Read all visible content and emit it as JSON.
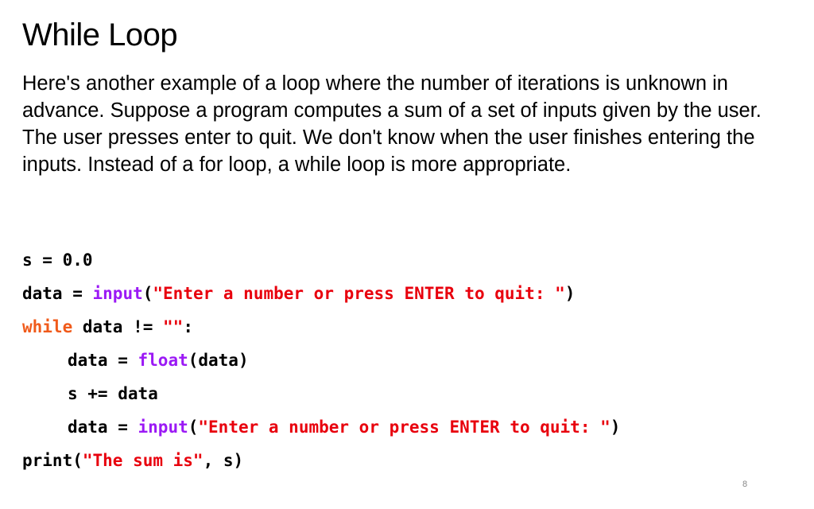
{
  "slide": {
    "title": "While Loop",
    "body": "Here's another example of a loop where the number of iterations is unknown in advance. Suppose a program computes a sum of a set of inputs given by the user. The user presses enter to quit.  We don't know when the user finishes entering the inputs. Instead of a for loop, a while loop is more appropriate.",
    "page_number": "8"
  },
  "colors": {
    "keyword": "#f05a1a",
    "builtin": "#9b19f5",
    "string": "#e8000d",
    "default": "#000000"
  },
  "code": {
    "lines": [
      {
        "tokens": [
          "s = 0.0"
        ]
      },
      {
        "tokens": [
          "data = ",
          "input",
          "(",
          "\"Enter a number or press ENTER to quit: \"",
          ")"
        ]
      },
      {
        "tokens": [
          "while",
          " data != ",
          "\"\"",
          ":"
        ]
      },
      {
        "tokens": [
          "data = ",
          "float",
          "(data)"
        ]
      },
      {
        "tokens": [
          "s += data"
        ]
      },
      {
        "tokens": [
          "data = ",
          "input",
          "(",
          "\"Enter a number or press ENTER to quit: \"",
          ")"
        ]
      },
      {
        "tokens": [
          "print(",
          "\"The sum is\"",
          ", s)"
        ]
      }
    ]
  }
}
